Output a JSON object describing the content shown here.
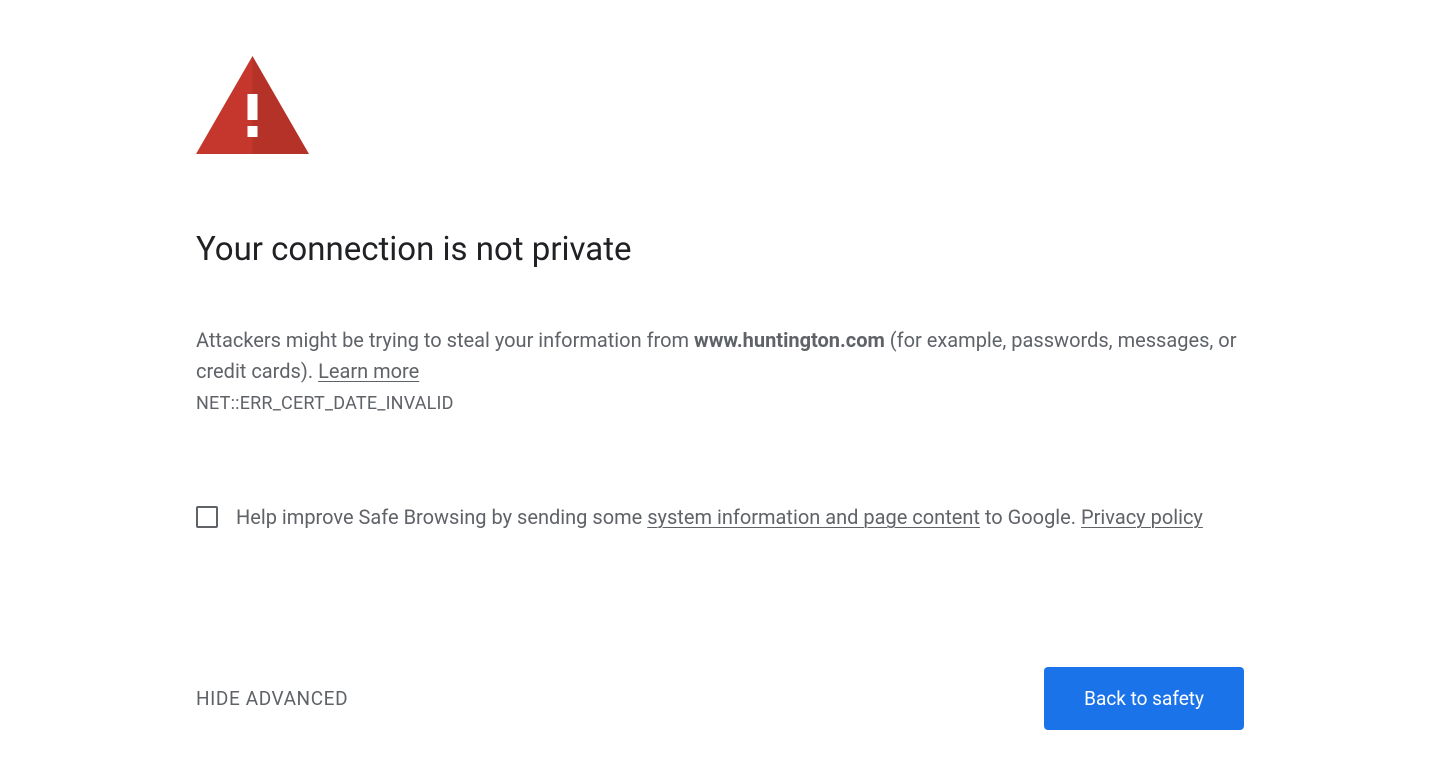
{
  "heading": "Your connection is not private",
  "body": {
    "before_host": "Attackers might be trying to steal your information from ",
    "host": "www.huntington.com",
    "after_host": " (for example, passwords, messages, or credit cards). ",
    "learn_more": "Learn more"
  },
  "error_code": "NET::ERR_CERT_DATE_INVALID",
  "optin": {
    "before_link": "Help improve Safe Browsing by sending some ",
    "system_link": "system information and page content",
    "after_link": " to Google. ",
    "privacy_link": "Privacy policy"
  },
  "nav": {
    "hide_advanced": "HIDE ADVANCED",
    "back_to_safety": "Back to safety"
  },
  "colors": {
    "danger": "#c5372c",
    "danger_dark": "#a32f26",
    "primary_btn": "#1a73e8",
    "text_muted": "#5f6368",
    "text": "#202124"
  }
}
